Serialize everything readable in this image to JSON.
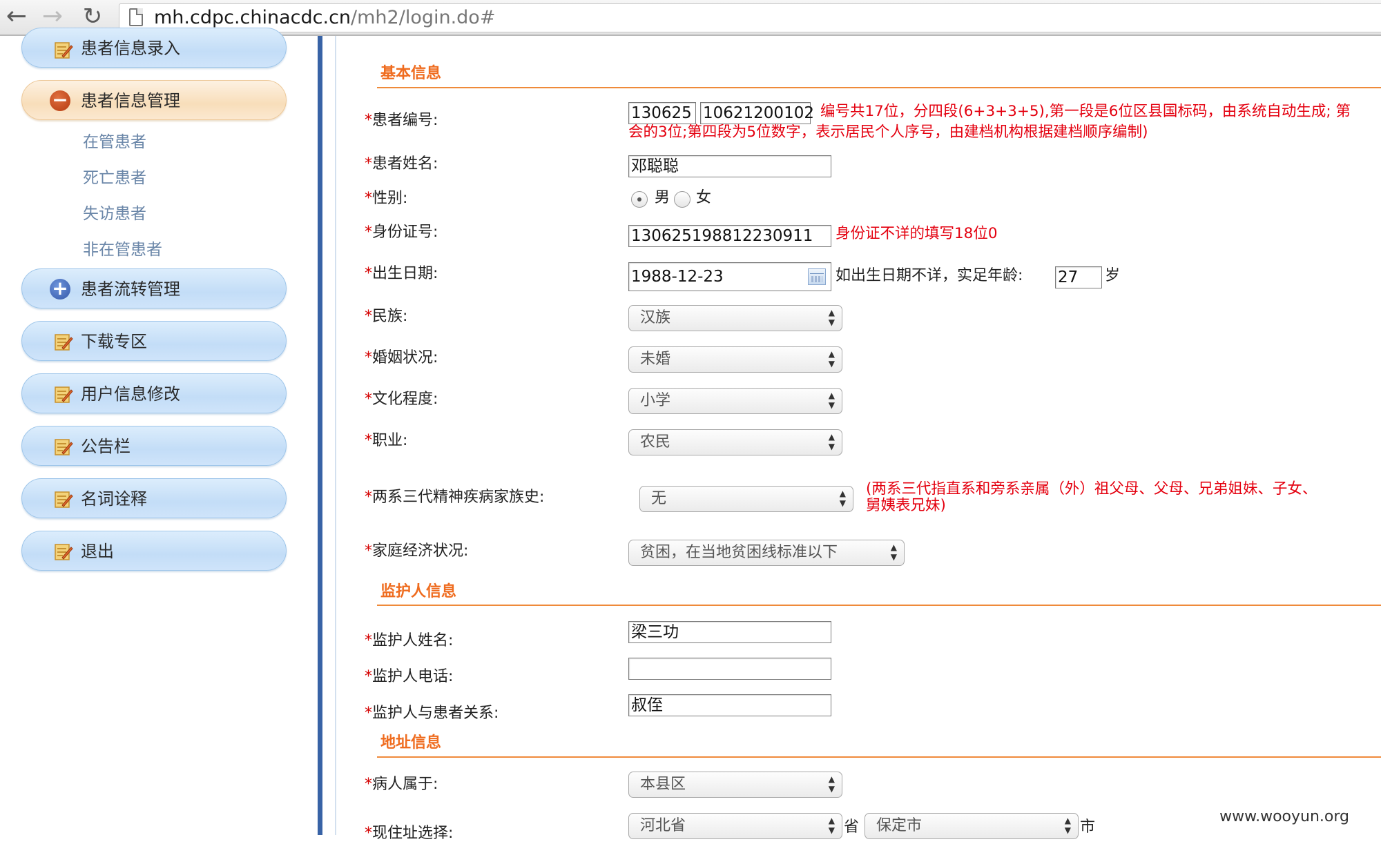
{
  "browser": {
    "url_host": "mh.cdpc.chinacdc.cn",
    "url_path": "/mh2/login.do#",
    "back_icon": "arrow-left-icon",
    "forward_icon": "arrow-right-icon",
    "reload_icon": "reload-icon"
  },
  "sidebar": {
    "menu_entry": "患者信息录入",
    "menu_manage": "患者信息管理",
    "sub_items": [
      "在管患者",
      "死亡患者",
      "失访患者",
      "非在管患者"
    ],
    "menu_transfer": "患者流转管理",
    "menu_download": "下载专区",
    "menu_user": "用户信息修改",
    "menu_notice": "公告栏",
    "menu_glossary": "名词诠释",
    "menu_logout": "退出"
  },
  "form": {
    "required_mark": "*",
    "basic_title": "基本信息",
    "patient_id_label": "患者编号:",
    "patient_id_part1": "130625",
    "patient_id_part2": "10621200102",
    "patient_id_hint_line1": "编号共17位，分四段(6+3+3+5),第一段是6位区县国标码，由系统自动生成; 第",
    "patient_id_hint_line2": "会的3位;第四段为5位数字，表示居民个人序号，由建档机构根据建档顺序编制)",
    "name_label": "患者姓名:",
    "name_value": "邓聪聪",
    "gender_label": "性别:",
    "gender_male": "男",
    "gender_female": "女",
    "idcard_label": "身份证号:",
    "idcard_value": "130625198812230911",
    "idcard_hint": "身份证不详的填写18位0",
    "birth_label": "出生日期:",
    "birth_value": "1988-12-23",
    "age_prompt": "如出生日期不详，实足年龄:",
    "age_value": "27",
    "age_unit": "岁",
    "ethnicity_label": "民族:",
    "ethnicity_value": "汉族",
    "marital_label": "婚姻状况:",
    "marital_value": "未婚",
    "education_label": "文化程度:",
    "education_value": "小学",
    "occupation_label": "职业:",
    "occupation_value": "农民",
    "family_history_label": "两系三代精神疾病家族史:",
    "family_history_value": "无",
    "family_history_hint_line1": "(两系三代指直系和旁系亲属（外）祖父母、父母、兄弟姐妹、子女、",
    "family_history_hint_line2": "舅姨表兄妹)",
    "economy_label": "家庭经济状况:",
    "economy_value": "贫困，在当地贫困线标准以下",
    "guardian_title": "监护人信息",
    "guardian_name_label": "监护人姓名:",
    "guardian_name_value": "梁三功",
    "guardian_phone_label": "监护人电话:",
    "guardian_phone_value": "",
    "guardian_relation_label": "监护人与患者关系:",
    "guardian_relation_value": "叔侄",
    "address_title": "地址信息",
    "belongs_label": "病人属于:",
    "belongs_value": "本县区",
    "current_address_label": "现住址选择:",
    "province_value": "河北省",
    "province_unit": "省",
    "city_value": "保定市",
    "city_unit": "市"
  },
  "watermark": "www.wooyun.org"
}
